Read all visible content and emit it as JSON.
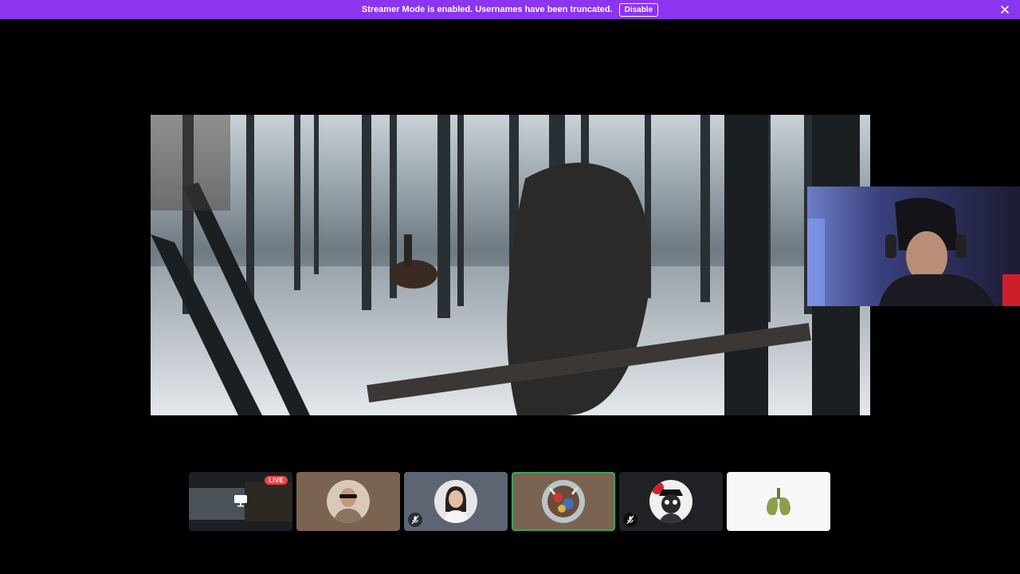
{
  "banner": {
    "message": "Streamer Mode is enabled. Usernames have been truncated.",
    "disable_label": "Disable",
    "close_icon": "close-icon",
    "color": "#8b35ef"
  },
  "stream": {
    "description_icon": "shared-screen-video"
  },
  "participants": [
    {
      "type": "screen-share",
      "badge": "LIVE",
      "icon": "monitor-icon",
      "muted": false
    },
    {
      "type": "avatar",
      "muted": false,
      "bg": "#7a6351"
    },
    {
      "type": "avatar",
      "muted": true,
      "bg": "#5e6572",
      "mute_icon": "mic-muted-icon"
    },
    {
      "type": "avatar",
      "muted": false,
      "speaking": true,
      "bg": "#7a6351"
    },
    {
      "type": "avatar",
      "muted": true,
      "bg": "#202225",
      "mute_icon": "mic-muted-icon"
    },
    {
      "type": "avatar",
      "muted": false,
      "bg": "#f7f7f7"
    }
  ],
  "colors": {
    "speaking_border": "#3ba55c",
    "live_badge": "#ed4245"
  }
}
